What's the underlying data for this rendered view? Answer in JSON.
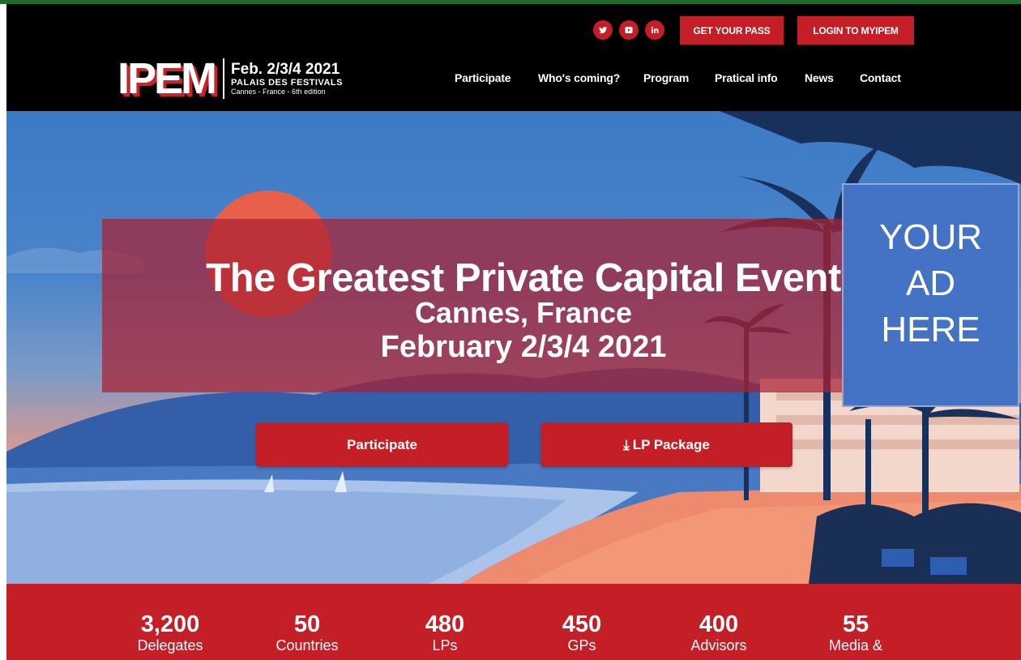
{
  "header": {
    "logo_text": "IPEM",
    "logo_date": "Feb. 2/3/4 2021",
    "logo_venue": "PALAIS DES FESTIVALS",
    "logo_city": "Cannes - France - 6th edition",
    "get_pass": "GET YOUR PASS",
    "login": "LOGIN TO MYIPEM",
    "socials": [
      "twitter-icon",
      "youtube-icon",
      "linkedin-icon"
    ],
    "nav": [
      "Participate",
      "Who's coming?",
      "Program",
      "Pratical info",
      "News",
      "Contact"
    ]
  },
  "hero": {
    "headline": "The Greatest Private Capital Event",
    "location": "Cannes, France",
    "dates": "February 2/3/4 2021",
    "cta_participate": "Participate",
    "cta_lp": "LP Package"
  },
  "ad": {
    "line1": "YOUR",
    "line2": "AD",
    "line3": "HERE"
  },
  "stats": [
    {
      "value": "3,200",
      "label": "Delegates"
    },
    {
      "value": "50",
      "label": "Countries"
    },
    {
      "value": "480",
      "label": "LPs"
    },
    {
      "value": "450",
      "label": "GPs"
    },
    {
      "value": "400",
      "label": "Advisors"
    },
    {
      "value": "55",
      "label": "Media &"
    }
  ],
  "colors": {
    "brand_red": "#c41e26",
    "header_bg": "#000000",
    "ad_blue": "#4472c4"
  }
}
